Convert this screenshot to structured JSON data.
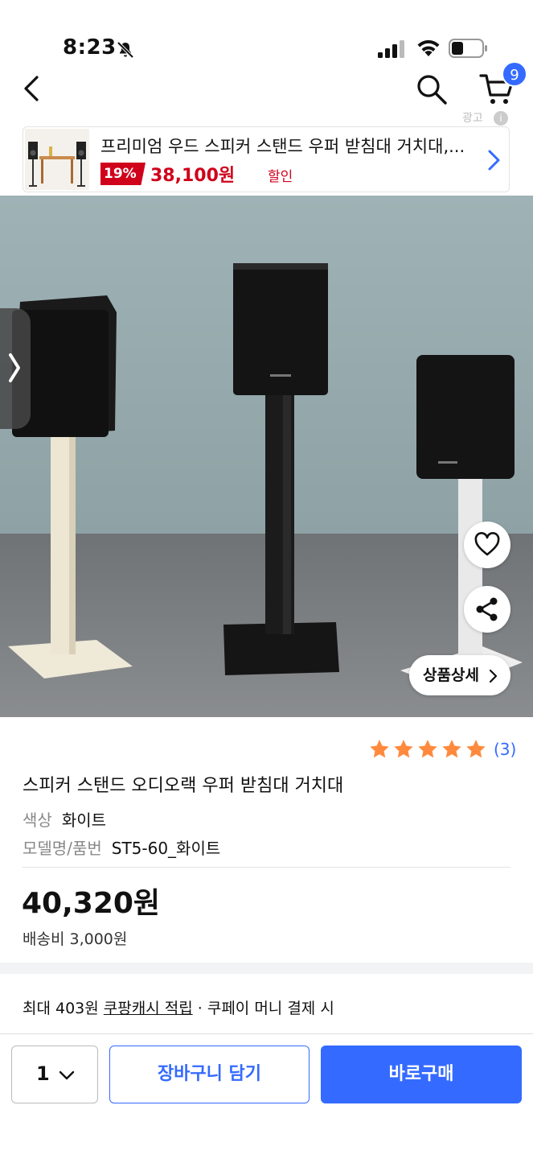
{
  "status_bar": {
    "time": "8:23"
  },
  "nav": {
    "cart_badge": "9"
  },
  "ad": {
    "title": "프리미엄 우드 스피커 스탠드 우퍼 받침대 거치대,...",
    "discount": "19%",
    "price": "38,100원",
    "sale_label": "할인"
  },
  "hero": {
    "detail_button": "상품상세"
  },
  "product": {
    "rating_stars": 5,
    "review_count": "(3)",
    "title": "스피커 스탠드 오디오랙 우퍼 받침대 거치대",
    "color_label": "색상",
    "color_value": "화이트",
    "model_label": "모델명/품번",
    "model_value": "ST5-60_화이트",
    "price": "40,320원",
    "shipping": "배송비 3,000원"
  },
  "cash": {
    "prefix": "최대 403원 ",
    "link": "쿠팡캐시 적립",
    "suffix": " · 쿠페이 머니 결제 시"
  },
  "bottom": {
    "quantity": "1",
    "add_to_cart": "장바구니 담기",
    "buy_now": "바로구매"
  },
  "colors": {
    "accent": "#346aff",
    "discount_red": "#d0021b",
    "star": "#ff8a3d"
  }
}
